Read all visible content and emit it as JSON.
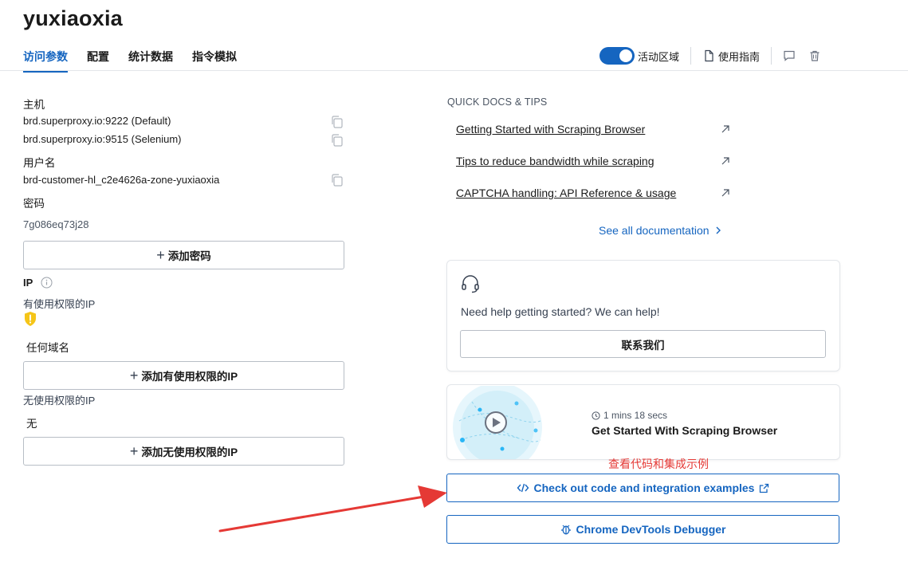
{
  "zone": {
    "title": "yuxiaoxia"
  },
  "tabs": [
    {
      "label": "访问参数",
      "active": true
    },
    {
      "label": "配置",
      "active": false
    },
    {
      "label": "统计数据",
      "active": false
    },
    {
      "label": "指令模拟",
      "active": false
    }
  ],
  "toolbar": {
    "active_zone_label": "活动区域",
    "active_zone_on": true,
    "guide_label": "使用指南"
  },
  "access": {
    "host_label": "主机",
    "hosts": [
      "brd.superproxy.io:9222 (Default)",
      "brd.superproxy.io:9515 (Selenium)"
    ],
    "username_label": "用户名",
    "username": "brd-customer-hl_c2e4626a-zone-yuxiaoxia",
    "password_label": "密码",
    "password": "7g086eq73j28",
    "add_password_label": "添加密码",
    "ip_label": "IP",
    "allowed_ip_label": "有使用权限的IP",
    "allowed_ip_value": "任何域名",
    "add_allowed_ip_label": "添加有使用权限的IP",
    "denied_ip_label": "无使用权限的IP",
    "denied_ip_value": "无",
    "add_denied_ip_label": "添加无使用权限的IP"
  },
  "docs": {
    "heading": "QUICK DOCS & TIPS",
    "links": [
      "Getting Started with Scraping Browser",
      "Tips to reduce bandwidth while scraping",
      "CAPTCHA handling: API Reference & usage"
    ],
    "see_all": "See all documentation"
  },
  "help": {
    "text": "Need help getting started? We can help!",
    "contact_label": "联系我们"
  },
  "video": {
    "duration": "1 mins 18 secs",
    "title": "Get Started With Scraping Browser"
  },
  "annotation": "查看代码和集成示例",
  "actions": {
    "code_examples_label": "Check out code and integration examples",
    "devtools_label": "Chrome DevTools Debugger"
  },
  "colors": {
    "accent": "#1565c0",
    "annotation_red": "#e53935",
    "warning_yellow": "#f5c518"
  }
}
